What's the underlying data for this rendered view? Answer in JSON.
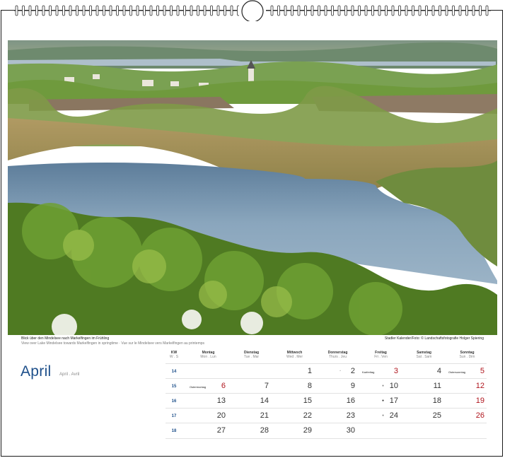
{
  "photo": {
    "caption_title": "Blick über den Mindelsee nach Markelfingen im Frühling",
    "caption_sub": "View over Lake Mindelsee towards Markelfingen in springtime · Vue sur le Mindelsee vers Markelfingen au printemps",
    "credit": "Stadler Kalender/Foto: © Landschaftsfotografie Holger Spiering"
  },
  "month": {
    "name": "April",
    "sub": "April . Avril"
  },
  "headers": [
    {
      "t": "KW",
      "s": "W . S"
    },
    {
      "t": "Montag",
      "s": "Mon . Lun"
    },
    {
      "t": "Dienstag",
      "s": "Tue . Mar"
    },
    {
      "t": "Mittwoch",
      "s": "Wed . Mer"
    },
    {
      "t": "Donnerstag",
      "s": "Thurs . Jeu"
    },
    {
      "t": "Freitag",
      "s": "Fri . Ven"
    },
    {
      "t": "Samstag",
      "s": "Sat . Sam"
    },
    {
      "t": "Sonntag",
      "s": "Sun . Dim"
    }
  ],
  "weeks": [
    {
      "kw": "14",
      "days": [
        "",
        "",
        "1",
        "2",
        "3",
        "4",
        "5"
      ],
      "red": [
        false,
        false,
        false,
        false,
        true,
        false,
        true
      ],
      "notes": [
        "",
        "",
        "",
        "",
        "Karfreitag",
        "",
        "Ostersonntag"
      ],
      "moons": [
        "",
        "",
        "",
        "◦",
        "",
        "",
        ""
      ]
    },
    {
      "kw": "15",
      "days": [
        "6",
        "7",
        "8",
        "9",
        "10",
        "11",
        "12"
      ],
      "red": [
        true,
        false,
        false,
        false,
        false,
        false,
        true
      ],
      "notes": [
        "Ostermontag",
        "",
        "",
        "",
        "",
        "",
        ""
      ],
      "moons": [
        "",
        "",
        "",
        "",
        "◗",
        "",
        ""
      ]
    },
    {
      "kw": "16",
      "days": [
        "13",
        "14",
        "15",
        "16",
        "17",
        "18",
        "19"
      ],
      "red": [
        false,
        false,
        false,
        false,
        false,
        false,
        true
      ],
      "notes": [
        "",
        "",
        "",
        "",
        "",
        "",
        ""
      ],
      "moons": [
        "",
        "",
        "",
        "",
        "●",
        "",
        ""
      ]
    },
    {
      "kw": "17",
      "days": [
        "20",
        "21",
        "22",
        "23",
        "24",
        "25",
        "26"
      ],
      "red": [
        false,
        false,
        false,
        false,
        false,
        false,
        true
      ],
      "notes": [
        "",
        "",
        "",
        "",
        "",
        "",
        ""
      ],
      "moons": [
        "",
        "",
        "",
        "",
        "◖",
        "",
        ""
      ]
    },
    {
      "kw": "18",
      "days": [
        "27",
        "28",
        "29",
        "30",
        "",
        "",
        ""
      ],
      "red": [
        false,
        false,
        false,
        false,
        false,
        false,
        false
      ],
      "notes": [
        "",
        "",
        "",
        "",
        "",
        "",
        ""
      ],
      "moons": [
        "",
        "",
        "",
        "",
        "",
        "",
        ""
      ]
    }
  ]
}
